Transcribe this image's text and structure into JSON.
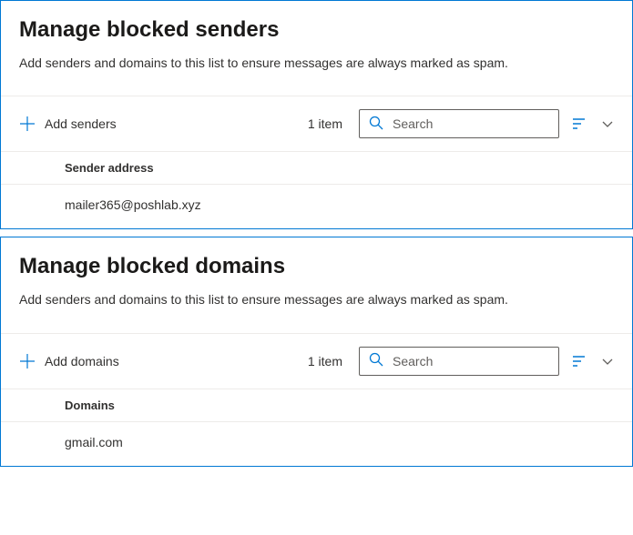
{
  "senders": {
    "title": "Manage blocked senders",
    "desc": "Add senders and domains to this list to ensure messages are always marked as spam.",
    "addLabel": "Add senders",
    "count": "1 item",
    "searchPlaceholder": "Search",
    "columnHeader": "Sender address",
    "rows": [
      "mailer365@poshlab.xyz"
    ]
  },
  "domains": {
    "title": "Manage blocked domains",
    "desc": "Add senders and domains to this list to ensure messages are always marked as spam.",
    "addLabel": "Add domains",
    "count": "1 item",
    "searchPlaceholder": "Search",
    "columnHeader": "Domains",
    "rows": [
      "gmail.com"
    ]
  }
}
